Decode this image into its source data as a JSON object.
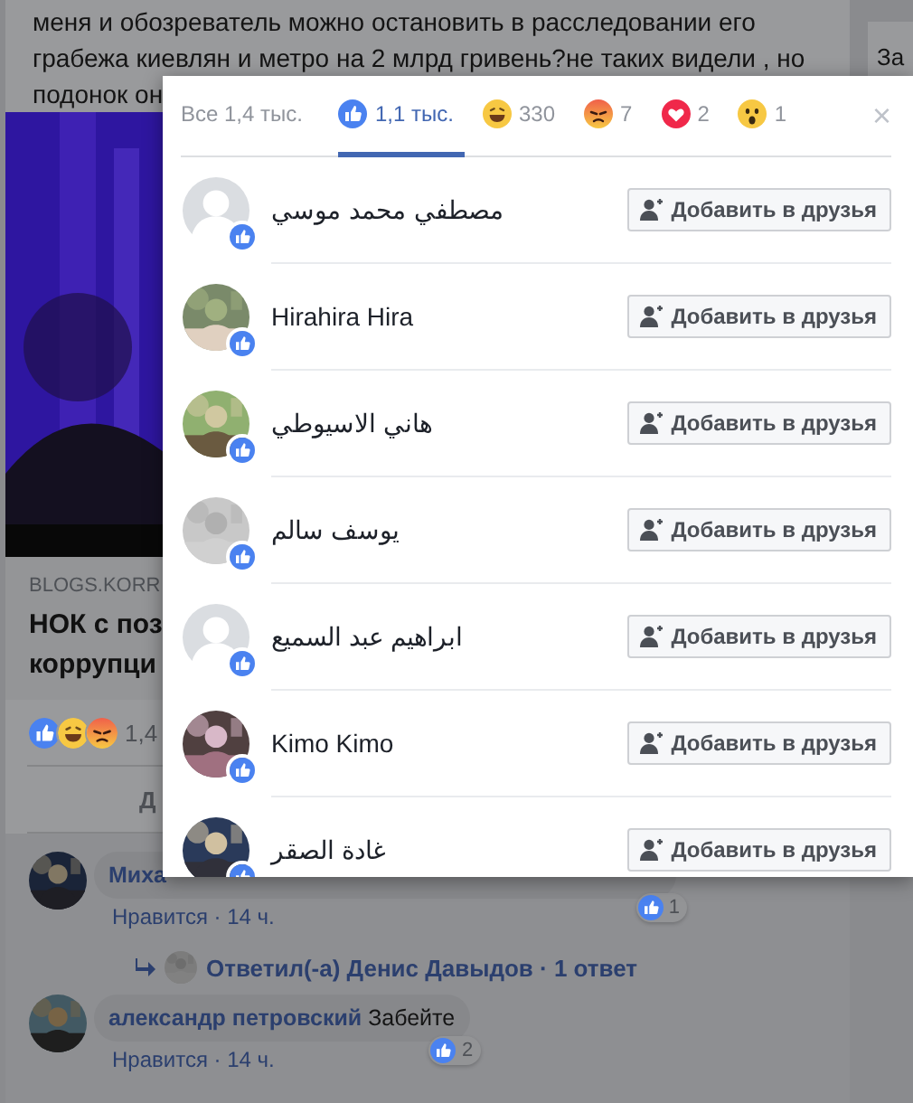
{
  "post": {
    "text_lines": [
      "меня и обозреватель можно остановить в расследовании его",
      "грабежа киевлян и метро на 2 млрд гривень?не таких видели , но",
      "подонок он"
    ],
    "link": {
      "domain": "BLOGS.KORR",
      "title_lines": [
        "НОК с поз",
        "коррупци"
      ]
    },
    "reactions": {
      "icons": [
        {
          "kind": "like"
        },
        {
          "kind": "haha"
        },
        {
          "kind": "angry"
        }
      ],
      "count": "1,4"
    },
    "action": "Д",
    "comments": [
      {
        "author": "Миха",
        "meta": "Нравится · 14 ч.",
        "likes": "1",
        "reply": "Ответил(-а) Денис Давыдов · 1 ответ"
      },
      {
        "author": "александр петровский",
        "text": "Забейте",
        "meta": "Нравится · 14 ч.",
        "likes": "2"
      }
    ]
  },
  "side": {
    "text": "За"
  },
  "modal": {
    "tabs": [
      {
        "kind": "all",
        "label": "Все 1,4 тыс.",
        "selected": false
      },
      {
        "kind": "like",
        "label": "1,1 тыс.",
        "selected": true
      },
      {
        "kind": "haha",
        "label": "330",
        "selected": false
      },
      {
        "kind": "angry",
        "label": "7",
        "selected": false
      },
      {
        "kind": "love",
        "label": "2",
        "selected": false
      },
      {
        "kind": "wow",
        "label": "1",
        "selected": false
      }
    ],
    "close": "×",
    "people": [
      {
        "name": "مصطفي محمد موسي",
        "kind": "default",
        "button": "Добавить в друзья"
      },
      {
        "name": "Hirahira Hira",
        "kind": "picture",
        "button": "Добавить в друзья"
      },
      {
        "name": "هاني الاسيوطي",
        "kind": "picture",
        "button": "Добавить в друзья"
      },
      {
        "name": "يوسف سالم",
        "kind": "picture",
        "button": "Добавить в друзья"
      },
      {
        "name": "ابراهيم عبد السميع",
        "kind": "default",
        "button": "Добавить в друзья"
      },
      {
        "name": "Kimo Kimo",
        "kind": "picture",
        "button": "Добавить в друзья"
      },
      {
        "name": "غادة الصقر",
        "kind": "picture",
        "button": "Добавить в друзья"
      }
    ]
  }
}
